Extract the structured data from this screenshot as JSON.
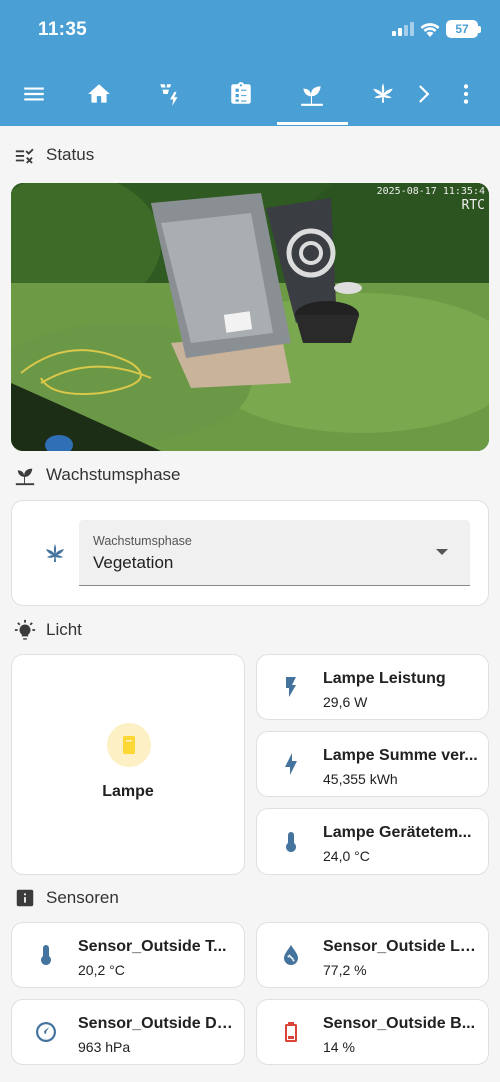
{
  "status_bar": {
    "time": "11:35",
    "battery": "57"
  },
  "toolbar": {
    "tabs": [
      "home",
      "energy",
      "clipboard",
      "sprout",
      "cannabis"
    ],
    "active_tab": "sprout"
  },
  "sections": {
    "status": "Status",
    "phase": "Wachstumsphase",
    "licht": "Licht",
    "sensoren": "Sensoren"
  },
  "camera": {
    "timestamp": "2025-08-17 11:35:4",
    "label": "RTC"
  },
  "phase_select": {
    "label": "Wachstumsphase",
    "value": "Vegetation"
  },
  "licht": {
    "lampe": {
      "name": "Lampe"
    },
    "tiles": [
      {
        "name": "Lampe Leistung",
        "state": "29,6 W",
        "icon": "flash-icon"
      },
      {
        "name": "Lampe Summe ver...",
        "state": "45,355 kWh",
        "icon": "lightning-icon"
      },
      {
        "name": "Lampe Gerätetem...",
        "state": "24,0 °C",
        "icon": "thermometer-icon"
      }
    ]
  },
  "sensoren": {
    "tiles": [
      {
        "name": "Sensor_Outside T...",
        "state": "20,2 °C",
        "icon": "thermometer-icon"
      },
      {
        "name": "Sensor_Outside Lu...",
        "state": "77,2 %",
        "icon": "humidity-icon"
      },
      {
        "name": "Sensor_Outside Dr...",
        "state": "963 hPa",
        "icon": "gauge-icon"
      },
      {
        "name": "Sensor_Outside B...",
        "state": "14 %",
        "icon": "battery-low-icon"
      }
    ]
  },
  "colors": {
    "header": "#4a9fd4",
    "icon": "#44739e",
    "battery_icon": "#db4437",
    "lamp_icon": "#fdd835"
  }
}
